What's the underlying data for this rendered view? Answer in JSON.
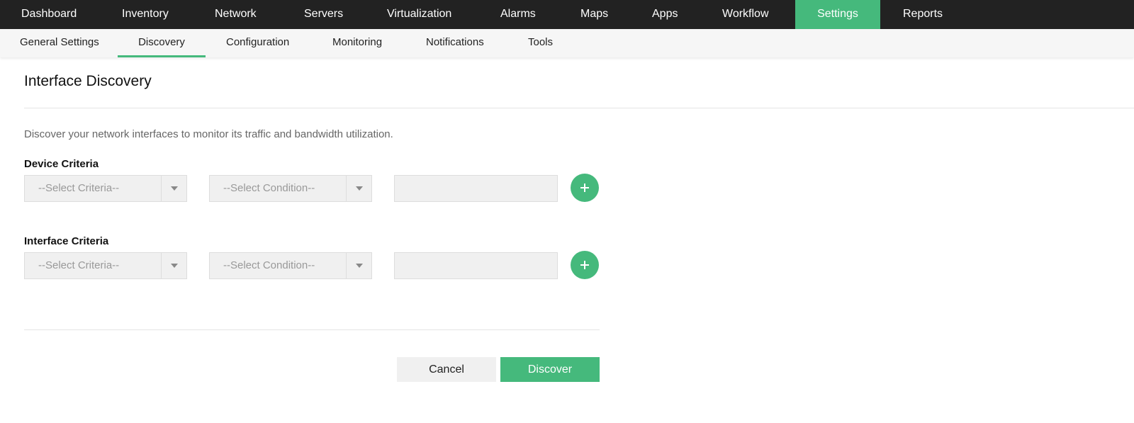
{
  "topnav": {
    "items": [
      {
        "label": "Dashboard"
      },
      {
        "label": "Inventory"
      },
      {
        "label": "Network"
      },
      {
        "label": "Servers"
      },
      {
        "label": "Virtualization"
      },
      {
        "label": "Alarms"
      },
      {
        "label": "Maps"
      },
      {
        "label": "Apps"
      },
      {
        "label": "Workflow"
      },
      {
        "label": "Settings",
        "active": true
      },
      {
        "label": "Reports"
      }
    ]
  },
  "subnav": {
    "items": [
      {
        "label": "General Settings"
      },
      {
        "label": "Discovery",
        "active": true
      },
      {
        "label": "Configuration"
      },
      {
        "label": "Monitoring"
      },
      {
        "label": "Notifications"
      },
      {
        "label": "Tools"
      }
    ]
  },
  "page": {
    "title": "Interface Discovery",
    "description": "Discover your network interfaces to monitor its traffic and bandwidth utilization."
  },
  "device_criteria": {
    "label": "Device Criteria",
    "criteria_select": "--Select Criteria--",
    "condition_select": "--Select Condition--",
    "value": ""
  },
  "interface_criteria": {
    "label": "Interface Criteria",
    "criteria_select": "--Select Criteria--",
    "condition_select": "--Select Condition--",
    "value": ""
  },
  "actions": {
    "cancel_label": "Cancel",
    "discover_label": "Discover"
  },
  "colors": {
    "accent": "#45b97c",
    "topnav_bg": "#222222",
    "subnav_bg": "#f6f6f6"
  },
  "icons": {
    "add": "plus-icon",
    "dropdown": "caret-down-icon"
  }
}
